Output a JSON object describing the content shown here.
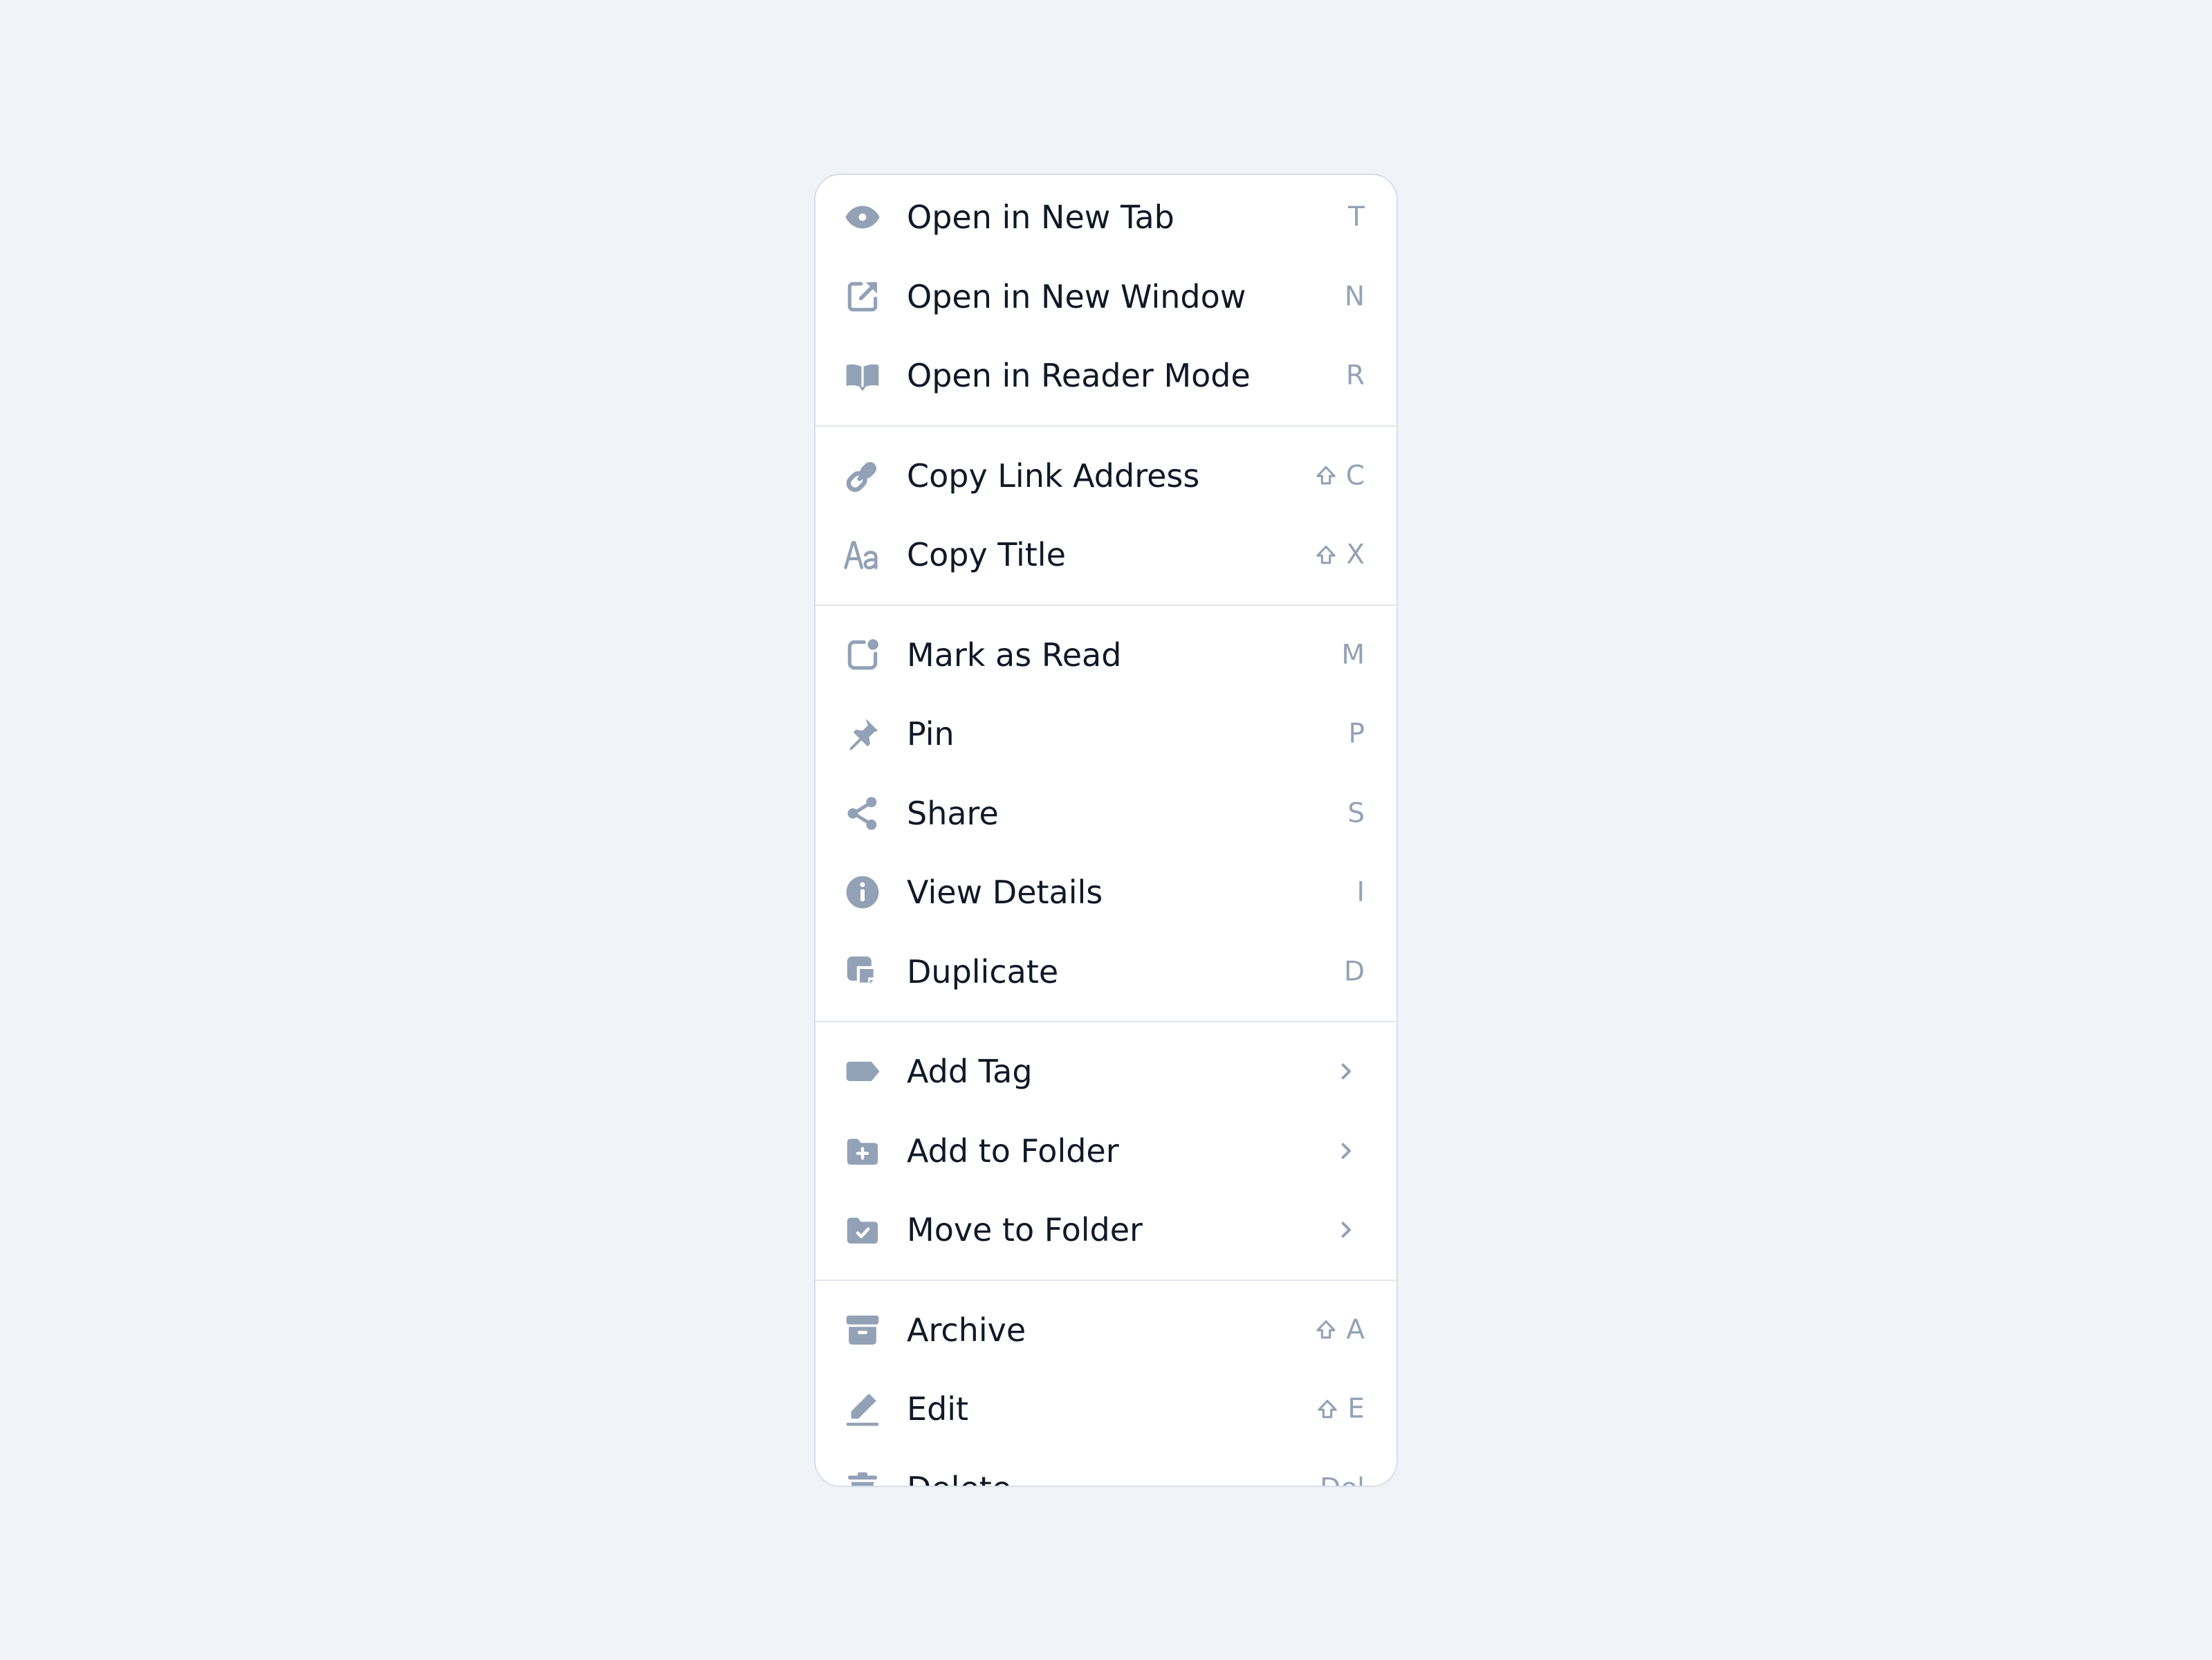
{
  "colors": {
    "background": "#f0f4f9",
    "menu_bg": "#ffffff",
    "icon": "#93a1b6",
    "label": "#111827",
    "shortcut": "#93a1b6",
    "divider": "#e1e6ee"
  },
  "menu": {
    "groups": [
      {
        "items": [
          {
            "label": "Open in New Tab",
            "icon": "eye-icon",
            "shortcut": "T"
          },
          {
            "label": "Open in New Window",
            "icon": "external-link-icon",
            "shortcut": "N"
          },
          {
            "label": "Open in Reader Mode",
            "icon": "book-open-icon",
            "shortcut": "R"
          }
        ]
      },
      {
        "items": [
          {
            "label": "Copy Link Address",
            "icon": "link-icon",
            "shortcut": "C",
            "shift": true
          },
          {
            "label": "Copy Title",
            "icon": "text-aa-icon",
            "shortcut": "X",
            "shift": true
          }
        ]
      },
      {
        "items": [
          {
            "label": "Mark as Read",
            "icon": "badge-dot-icon",
            "shortcut": "M"
          },
          {
            "label": "Pin",
            "icon": "pin-icon",
            "shortcut": "P"
          },
          {
            "label": "Share",
            "icon": "share-icon",
            "shortcut": "S"
          },
          {
            "label": "View Details",
            "icon": "info-icon",
            "shortcut": "I"
          },
          {
            "label": "Duplicate",
            "icon": "duplicate-icon",
            "shortcut": "D"
          }
        ]
      },
      {
        "items": [
          {
            "label": "Add Tag",
            "icon": "tag-icon",
            "submenu": true
          },
          {
            "label": "Add to Folder",
            "icon": "folder-plus-icon",
            "submenu": true
          },
          {
            "label": "Move to Folder",
            "icon": "folder-check-icon",
            "submenu": true
          }
        ]
      },
      {
        "items": [
          {
            "label": "Archive",
            "icon": "archive-icon",
            "shortcut": "A",
            "shift": true
          },
          {
            "label": "Edit",
            "icon": "pencil-icon",
            "shortcut": "E",
            "shift": true
          },
          {
            "label": "Delete",
            "icon": "trash-icon",
            "shortcut": "Del"
          }
        ]
      }
    ]
  }
}
